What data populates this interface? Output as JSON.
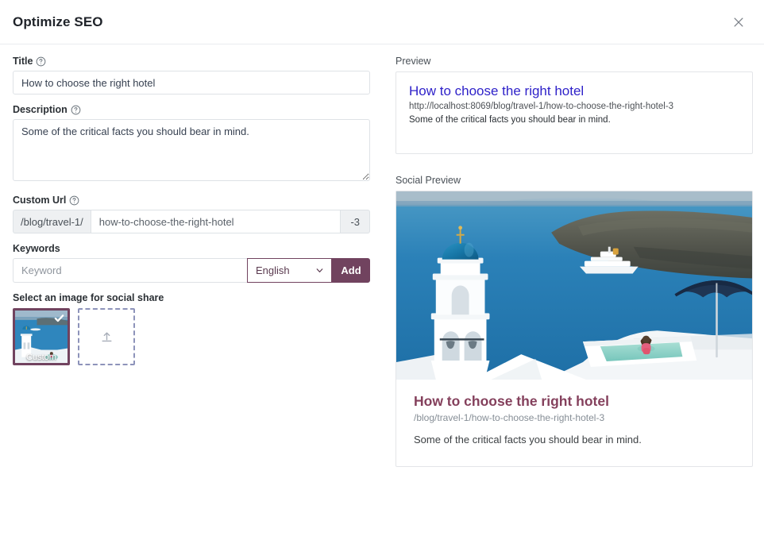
{
  "header": {
    "title": "Optimize SEO",
    "close_icon": "close-icon"
  },
  "form": {
    "title_label": "Title",
    "title_value": "How to choose the right hotel",
    "description_label": "Description",
    "description_value": "Some of the critical facts you should bear in mind.",
    "custom_url_label": "Custom Url",
    "url_prefix": "/blog/travel-1/",
    "url_value": "how-to-choose-the-right-hotel",
    "url_suffix": "-3",
    "keywords_label": "Keywords",
    "keyword_placeholder": "Keyword",
    "keyword_value": "",
    "language_selected": "English",
    "add_button": "Add",
    "image_select_label": "Select an image for social share",
    "thumb_custom_caption": "Custom",
    "help_icon": "help-circle-icon",
    "caret_icon": "chevron-down-icon",
    "check_icon": "check-icon",
    "upload_icon": "upload-icon"
  },
  "preview": {
    "section_label": "Preview",
    "title": "How to choose the right hotel",
    "url": "http://localhost:8069/blog/travel-1/how-to-choose-the-right-hotel-3",
    "description": "Some of the critical facts you should bear in mind."
  },
  "social": {
    "section_label": "Social Preview",
    "image_alt": "santorini-blue-dome-church-and-infinity-pool-overlooking-caldera-with-cruise-ship",
    "title": "How to choose the right hotel",
    "url": "/blog/travel-1/how-to-choose-the-right-hotel-3",
    "description": "Some of the critical facts you should bear in mind."
  },
  "colors": {
    "brand_purple": "#71435f",
    "social_title": "#84405c",
    "google_link": "#2f22c9",
    "border": "#dee2e6",
    "sea_blue": "#2f86bd",
    "dome_blue": "#1b7aad"
  }
}
